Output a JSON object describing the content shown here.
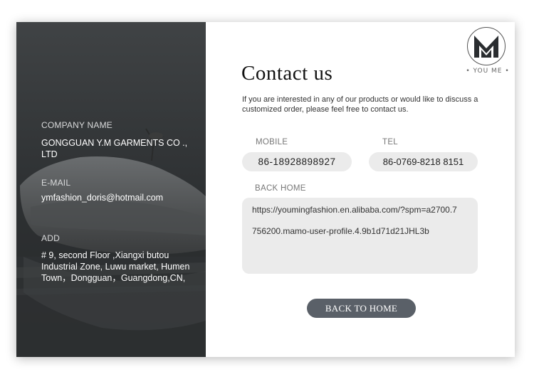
{
  "brand": {
    "logo_text": "• YOU ME •"
  },
  "company": {
    "name_label": "COMPANY NAME",
    "name": "GONGGUAN Y.M GARMENTS CO ., LTD",
    "email_label": "E-MAIL",
    "email": "ymfashion_doris@hotmail.com",
    "address_label": "ADD",
    "address": "# 9, second Floor ,Xiangxi butou Industrial Zone, Luwu market, Humen Town，Dongguan，Guangdong,CN,"
  },
  "contact": {
    "title": "Contact us",
    "intro": "If you are interested in any of our products or would like to discuss a customized order, please feel free to contact us.",
    "mobile_label": "MOBILE",
    "mobile": "86-18928898927",
    "tel_label": "TEL",
    "tel": "86-0769-8218 8151",
    "home_label": "BACK HOME",
    "home_url_line1": "https://youmingfashion.en.alibaba.com/?spm=a2700.7",
    "home_url_line2": "756200.mamo-user-profile.4.9b1d71d21JHL3b",
    "button_label": "BACK TO HOME"
  }
}
